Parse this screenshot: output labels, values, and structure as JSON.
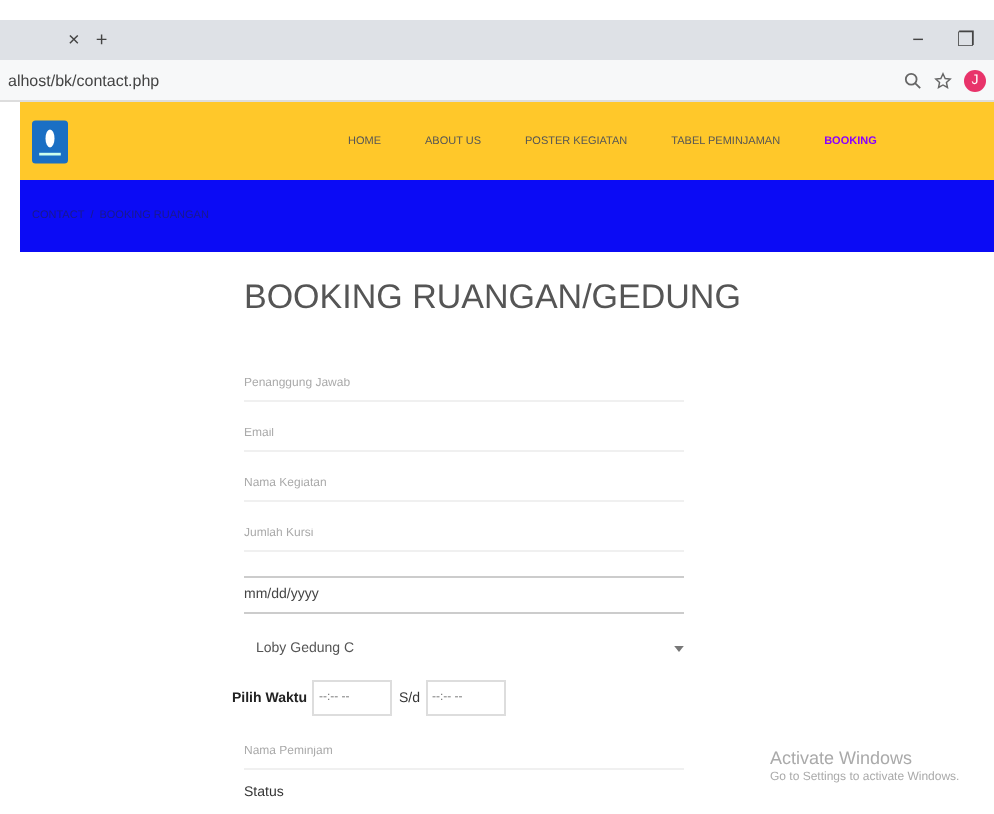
{
  "browser": {
    "tab_close": "×",
    "new_tab": "+",
    "url": "alhost/bk/contact.php",
    "window_controls": [
      "−",
      "❐"
    ],
    "profile": "J"
  },
  "nav": {
    "items": [
      {
        "label": "HOME",
        "selected": false
      },
      {
        "label": "ABOUT US",
        "selected": false
      },
      {
        "label": "POSTER KEGIATAN",
        "selected": false
      },
      {
        "label": "TABEL PEMINJAMAN",
        "selected": false
      },
      {
        "label": "BOOKING",
        "selected": true
      }
    ]
  },
  "breadcrumb": [
    "CONTACT",
    "/",
    "BOOKING RUANGAN"
  ],
  "form": {
    "title": "BOOKING RUANGAN/GEDUNG",
    "fields": [
      {
        "kind": "text",
        "placeholder": "Penanggung Jawab"
      },
      {
        "kind": "text",
        "placeholder": "Email"
      },
      {
        "kind": "text",
        "placeholder": "Nama Kegiatan"
      },
      {
        "kind": "text",
        "placeholder": "Jumlah Kursi"
      },
      {
        "kind": "date",
        "value": "mm/dd/yyyy"
      },
      {
        "kind": "select",
        "value": "Loby Gedung C"
      },
      {
        "kind": "time",
        "label": "Pilih Waktu",
        "start": "--:-- --",
        "separator": "S/d",
        "end": "--:-- --"
      },
      {
        "kind": "text",
        "placeholder": "Nama Peminjam"
      },
      {
        "kind": "label",
        "label": "Status"
      }
    ]
  },
  "activation": {
    "title": "Activate Windows",
    "message": "Go to Settings to activate Windows."
  }
}
